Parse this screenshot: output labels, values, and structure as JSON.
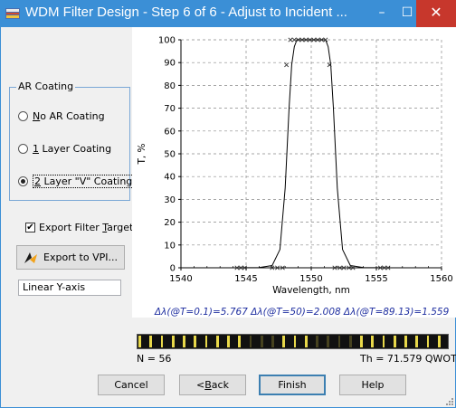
{
  "window": {
    "title": "WDM Filter Design - Step 6 of 6 - Adjust to Incident ...",
    "minimize_glyph": "–",
    "maximize_glyph": "☐",
    "close_glyph": "✕"
  },
  "ar_coating": {
    "legend": "AR Coating",
    "options": [
      {
        "mnemonic": "N",
        "rest": "o AR Coating",
        "checked": false
      },
      {
        "mnemonic": "1",
        "rest": " Layer Coating",
        "checked": false
      },
      {
        "mnemonic": "2",
        "rest": " Layer \"V\" Coating",
        "checked": true
      }
    ]
  },
  "export_filter": {
    "label_pre": "Export Filter ",
    "mnemonic": "T",
    "label_post": "arget",
    "checked": true,
    "check_glyph": "✔"
  },
  "export_button": {
    "label": "Export to VPI..."
  },
  "y_axis_mode": {
    "value": "Linear Y-axis"
  },
  "chart_data": {
    "type": "line",
    "xlabel": "Wavelength, nm",
    "ylabel": "T, %",
    "xlim": [
      1540,
      1560
    ],
    "ylim": [
      0,
      100
    ],
    "x_ticks": [
      1540,
      1545,
      1550,
      1555,
      1560
    ],
    "y_ticks": [
      0,
      10,
      20,
      30,
      40,
      50,
      60,
      70,
      80,
      90,
      100
    ],
    "grid": true,
    "series": [
      {
        "x": [
          1540,
          1544,
          1546,
          1547,
          1547.6,
          1548.0,
          1548.3,
          1548.5,
          1548.7,
          1548.9,
          1549.3,
          1550,
          1550.7,
          1551.1,
          1551.3,
          1551.5,
          1551.7,
          1552.0,
          1552.4,
          1553,
          1554,
          1556,
          1560
        ],
        "y": [
          0.0,
          0.0,
          0.1,
          1.0,
          8.0,
          35.0,
          70.0,
          89.0,
          97.0,
          100,
          100,
          100,
          100,
          100,
          97.0,
          89.0,
          70.0,
          35.0,
          8.0,
          1.0,
          0.1,
          0.0,
          0.0
        ]
      }
    ],
    "markers": {
      "x": [
        1547,
        1547.4,
        1547.8,
        1548.1,
        1548.4,
        1548.7,
        1549.0,
        1549.3,
        1549.6,
        1549.9,
        1550.2,
        1550.5,
        1550.8,
        1551.1,
        1551.4,
        1551.8,
        1552.2,
        1552.5,
        1552.9,
        1553.2
      ],
      "y": [
        0.0,
        0.0,
        0.0,
        89.0,
        100,
        100,
        100,
        100,
        100,
        100,
        100,
        100,
        100,
        100,
        89.0,
        0.0,
        0.0,
        0.0,
        0.0,
        0.0
      ]
    },
    "bottom_markers_x": [
      1544.3,
      1544.6,
      1544.9,
      1555.3,
      1555.6,
      1555.9
    ],
    "annotation": "Δλ(@T=0.1)=5.767  Δλ(@T=50)=2.008  Δλ(@T=89.13)=1.559"
  },
  "layer_stack": {
    "count_text": "N = 56",
    "thickness_text": "Th = 71.579 QWOT"
  },
  "buttons": {
    "cancel": "Cancel",
    "back_pre": "< ",
    "back_mnemonic": "B",
    "back_post": "ack",
    "finish": "Finish",
    "help": "Help"
  },
  "colors": {
    "titlebar": "#3b8fd6",
    "close": "#c7372c",
    "annotation": "#1f2fa0",
    "layer_dark": "#111111",
    "layer_light": "#e8d84a"
  }
}
